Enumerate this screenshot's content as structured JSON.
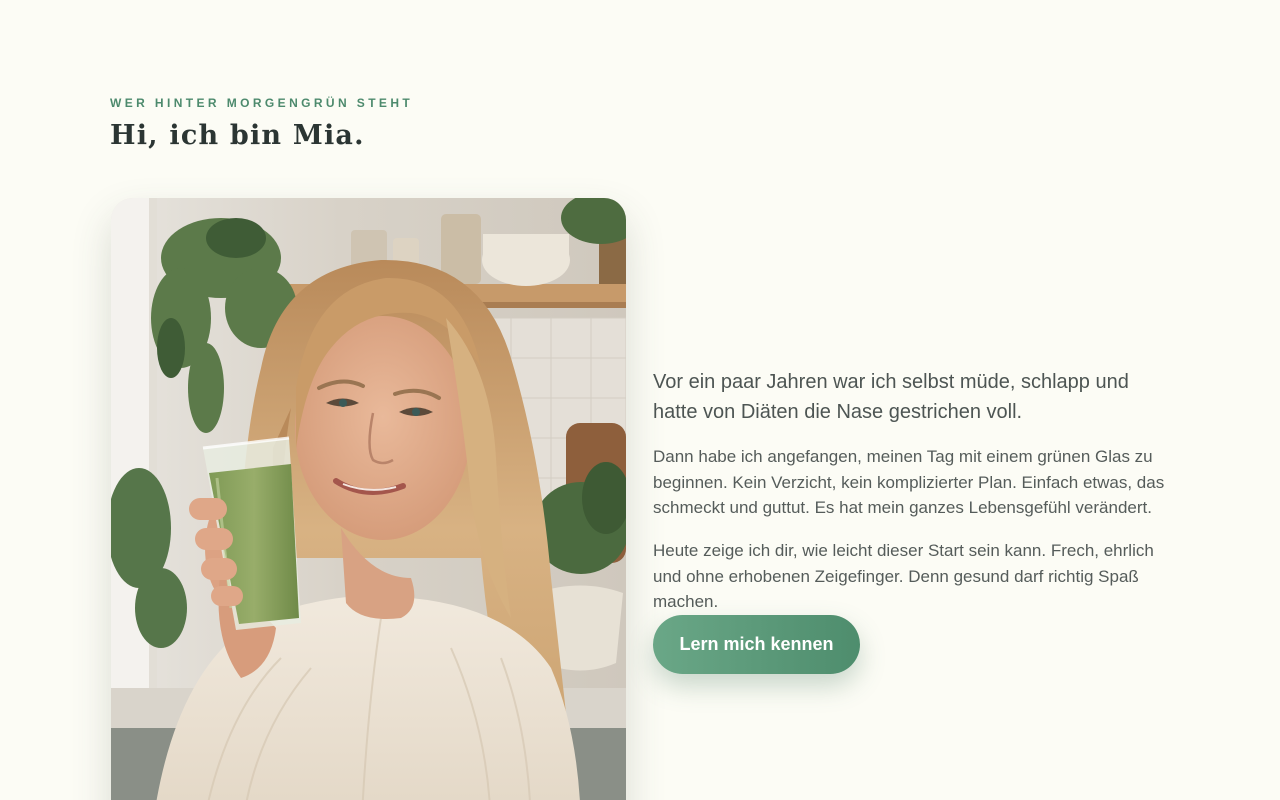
{
  "section": {
    "eyebrow": "WER HINTER MORGENGRÜN STEHT",
    "headline": "Hi, ich bin Mia."
  },
  "photo": {
    "subject": "woman-holding-green-smoothie"
  },
  "content": {
    "lead": "Vor ein paar Jahren war ich selbst müde, schlapp und hatte von Diäten die Nase gestrichen voll.",
    "paragraphs": [
      "Dann habe ich angefangen, meinen Tag mit einem grünen Glas zu beginnen. Kein Verzicht, kein komplizierter Plan. Einfach etwas, das schmeckt und guttut. Es hat mein ganzes Lebensgefühl verändert.",
      "Heute zeige ich dir, wie leicht dieser Start sein kann. Frech, ehrlich und ohne erhobenen Zeigefinger. Denn gesund darf richtig Spaß machen."
    ]
  },
  "cta": {
    "label": "Lern mich kennen"
  },
  "colors": {
    "background": "#fcfcf5",
    "accent": "#4d8a6d",
    "button_start": "#6aa787",
    "button_end": "#4e8d6d"
  }
}
